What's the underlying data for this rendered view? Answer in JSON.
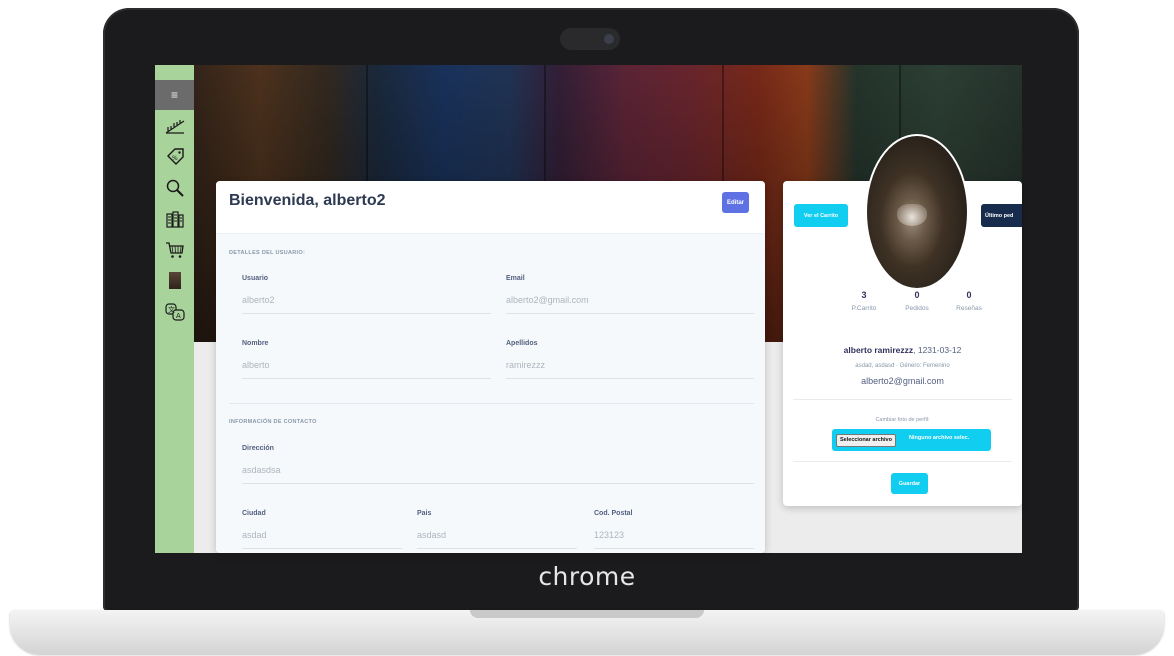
{
  "device": {
    "brand": "chrome"
  },
  "sidebar": {
    "toggle_glyph": "≡",
    "icons": [
      "ruler-icon",
      "discount-tag-icon",
      "search-icon",
      "buildings-icon",
      "shopping-cart-icon",
      "profile-thumbnail",
      "translate-icon"
    ]
  },
  "main_card": {
    "title": "Bienvenida, alberto2",
    "edit_label": "Editar",
    "section_user": "DETALLES DEL USUARIO:",
    "fields": {
      "usuario": {
        "label": "Usuario",
        "value": "alberto2"
      },
      "email": {
        "label": "Email",
        "value": "alberto2@gmail.com"
      },
      "nombre": {
        "label": "Nombre",
        "value": "alberto"
      },
      "apellidos": {
        "label": "Apellidos",
        "value": "ramirezzz"
      },
      "direccion": {
        "label": "Dirección",
        "value": "asdasdsa"
      },
      "ciudad": {
        "label": "Ciudad",
        "value": "asdad"
      },
      "pais": {
        "label": "Pais",
        "value": "asdasd"
      },
      "postal": {
        "label": "Cod. Postal",
        "value": "123123"
      }
    },
    "section_contact": "INFORMACIÓN DE CONTACTO"
  },
  "profile_card": {
    "cart_button": "Ver el Carrito",
    "last_orders_button": "Último ped",
    "stats": [
      {
        "value": "3",
        "label": "P.Carrito"
      },
      {
        "value": "0",
        "label": "Pedidos"
      },
      {
        "value": "0",
        "label": "Reseñas"
      }
    ],
    "name": "alberto ramirezzz",
    "birthdate": ", 1231-03-12",
    "meta": "asdad, asdasd · Género: Femenino",
    "email": "alberto2@gmail.com",
    "photo_label": "Cambiar foto de perfil:",
    "file_button": "Seleccionar archivo",
    "file_status": "Ninguno archivo selec.",
    "save_button": "Guardar"
  },
  "colors": {
    "sidebar": "#a8d39a",
    "primary": "#5e72e4",
    "info": "#11cdef",
    "dark": "#172b4d"
  }
}
